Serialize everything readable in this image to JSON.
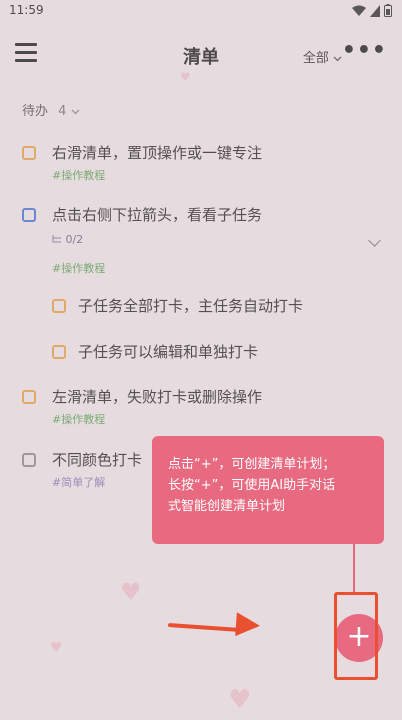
{
  "status_bar": {
    "time": "11:59"
  },
  "header": {
    "title": "清单",
    "filter_label": "全部",
    "more_label": "•••"
  },
  "section": {
    "label": "待办",
    "count": "4"
  },
  "tasks": [
    {
      "label": "右滑清单，置顶操作或一键专注",
      "tag": "#操作教程"
    },
    {
      "label": "点击右侧下拉箭头，看看子任务",
      "subcount": "0/2",
      "tag": "#操作教程"
    },
    {
      "label": "子任务全部打卡，主任务自动打卡"
    },
    {
      "label": "子任务可以编辑和单独打卡"
    },
    {
      "label": "左滑清单，失败打卡或删除操作",
      "tag": "#操作教程"
    },
    {
      "label": "不同颜色打卡",
      "tag": "#简单了解"
    }
  ],
  "tooltip": {
    "line1": "点击“+”，可创建清单计划；",
    "line2": "长按“+”，可使用AI助手对话",
    "line3": "式智能创建清单计划"
  },
  "fab": {
    "label": "+"
  },
  "colors": {
    "accent": "#e86a81",
    "arrow": "#e8502f",
    "tag_green": "#5fa45a"
  }
}
